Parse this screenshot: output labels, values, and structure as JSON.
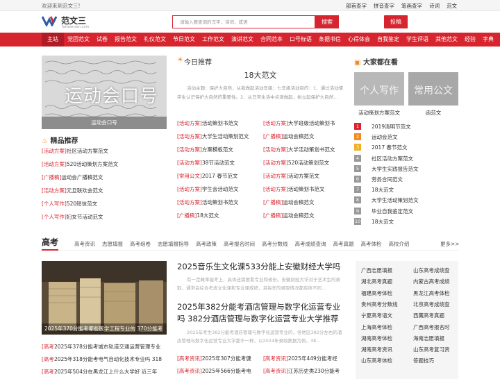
{
  "topbar": {
    "welcome": "欢迎来到范文三!",
    "links": [
      "部首查字",
      "拼音查字",
      "笔画查字",
      "诗词",
      "范文"
    ]
  },
  "logo": {
    "name": "范文三",
    "sub": "fanwensan.com"
  },
  "search": {
    "placeholder": "请输入要查询的汉字，诗词，成语",
    "button": "搜索"
  },
  "contribute": "投稿",
  "nav": [
    "主站",
    "党团范文",
    "试卷",
    "报告范文",
    "礼仪范文",
    "节日范文",
    "工作范文",
    "演讲范文",
    "合同范本",
    "口号标语",
    "条据书信",
    "心得体会",
    "自我鉴定",
    "学生评语",
    "其他范文",
    "经验",
    "字典"
  ],
  "banner": {
    "big": "运动会口号",
    "caption": "运动会口号"
  },
  "featured": {
    "title": "精品推荐",
    "items": [
      {
        "tag": "[活动方案]",
        "text": "社区活动方案范文"
      },
      {
        "tag": "[活动方案]",
        "text": "520活动策划方案范文"
      },
      {
        "tag": "[广播稿]",
        "text": "运动会广播稿范文"
      },
      {
        "tag": "[活动方案]",
        "text": "元旦联欢会范文"
      },
      {
        "tag": "[个人写作]",
        "text": "520短信范文"
      },
      {
        "tag": "[个人写作]",
        "text": "妇女节活动范文"
      }
    ]
  },
  "today": {
    "head": "今日推荐",
    "title": "18大范文",
    "desc": "活动主题：保护大自然，从我做起活动年级：七年级活动目的：1、通过活动使学生认识保护大自然的重要性。2、从日常生活中点滴做起，树立起保护大自然…",
    "left": [
      {
        "tag": "[活动方案]",
        "text": "活动策划书范文"
      },
      {
        "tag": "[活动方案]",
        "text": "大学生活动策划范文"
      },
      {
        "tag": "[活动方案]",
        "text": "方案模板范文"
      },
      {
        "tag": "[活动方案]",
        "text": "38节活动范文"
      },
      {
        "tag": "[常用公文]",
        "text": "2017 春节范文"
      },
      {
        "tag": "[活动方案]",
        "text": "学生会活动范文"
      },
      {
        "tag": "[活动方案]",
        "text": "活动策划书范文"
      },
      {
        "tag": "[广播稿]",
        "text": "18大范文"
      }
    ],
    "right": [
      {
        "tag": "[活动方案]",
        "text": "大学班级活动策划书"
      },
      {
        "tag": "[广播稿]",
        "text": "运动会稿范文"
      },
      {
        "tag": "[活动方案]",
        "text": "大学活动策划书范文"
      },
      {
        "tag": "[活动方案]",
        "text": "520活动策划范文"
      },
      {
        "tag": "[活动方案]",
        "text": "活动方案范文"
      },
      {
        "tag": "[活动方案]",
        "text": "活动策划书范文"
      },
      {
        "tag": "[广播稿]",
        "text": "运动会稿范文"
      },
      {
        "tag": "[广播稿]",
        "text": "运动会稿范文"
      }
    ]
  },
  "popular": {
    "head": "大家都在看",
    "thumbs": [
      {
        "label": "个人写作",
        "caption": "活动策划方案范文"
      },
      {
        "label": "常用公文",
        "caption": "函范文"
      }
    ],
    "ranks": [
      "2019清明节范文",
      "运动会范文",
      "2017 春节范文",
      "社区活动方案范文",
      "大学生实践报告范文",
      "劳务合同范文",
      "18大范文",
      "大学生活动策划范文",
      "毕业自我鉴定范文",
      "18大范文"
    ]
  },
  "gaokao": {
    "head": "高考",
    "tabs": [
      "高考资讯",
      "志愿填报",
      "高考组卷",
      "志愿填报指导",
      "高考政策",
      "高考报名时间",
      "高考分数线",
      "高考成绩查询",
      "高考真题",
      "高考体检",
      "高校介绍"
    ],
    "more": "更多>>",
    "image_caption": "2025年370分能考哪些医学工程专业的 370分能考",
    "left_list": [
      {
        "tag": "[高考",
        "text": "2025年378分能考城市轨道交通运营管理专业"
      },
      {
        "tag": "[高考",
        "text": "2025年318分能考电气自动化技术专业吗 318"
      },
      {
        "tag": "[高考",
        "text": "2025年504分在黑龙江上什么大学好 近三年"
      }
    ],
    "article1": {
      "title": "2025音乐生文化课533分能上安徽财经大学吗",
      "desc": "有一定概率能考上，具体还需要看专业和省份。安徽财经大学对于艺术生的录取，通常会综合考虑文化课和专业课成绩，且每年的录取情况都有所不同…"
    },
    "article2": {
      "title": "2025年382分能考酒店管理与数字化运营专业吗 382分酒店管理与数字化运营专业大学推荐",
      "desc": "2025年考生382分能考酒店管理与数字化运营专业的，各地区382分左右的酒店管理与数字化运营专业大学都不一样，以2024年录取数据为例，38…"
    },
    "bottom_list": [
      {
        "tag": "[高考资讯]",
        "text": "2025年307分能考健"
      },
      {
        "tag": "[高考资讯]",
        "text": "2025年449分能考经"
      },
      {
        "tag": "[高考资讯]",
        "text": "2025年566分能考电"
      },
      {
        "tag": "[高考资讯]",
        "text": "江苏历史类230分能考"
      }
    ],
    "side": [
      [
        "广西志愿填报",
        "山东高考成绩查"
      ],
      [
        "湖北高考真题",
        "内蒙古高考成绩"
      ],
      [
        "福建高考体检",
        "黑龙江高考体检"
      ],
      [
        "贵州高考分数线",
        "北京高考成绩查"
      ],
      [
        "宁夏高考语文",
        "西藏高考真题"
      ],
      [
        "上海高考体检",
        "广西高考报名时"
      ],
      [
        "湖南高考体检",
        "海南志愿填报"
      ],
      [
        "湖南高考资讯",
        "山东高考复习资"
      ],
      [
        "山东高考体检",
        "答题技巧"
      ]
    ]
  }
}
